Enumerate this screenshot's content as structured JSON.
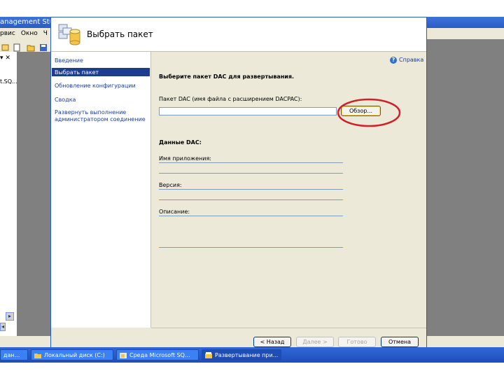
{
  "background_app": {
    "title": "anagement Stud",
    "menu": [
      "рвис",
      "Окно",
      "Ч"
    ],
    "explorer_close": "▾ ✕",
    "explorer_node": "t.SQ..."
  },
  "dialog": {
    "title": "Выбрать пакет",
    "help_label": "Справка",
    "nav": [
      {
        "label": "Введение",
        "selected": false
      },
      {
        "label": "Выбрать пакет",
        "selected": true
      },
      {
        "label": "Обновление конфигурации",
        "selected": false
      },
      {
        "label": "Сводка",
        "selected": false
      },
      {
        "label": "Развернуть выполнение администратором соединение",
        "selected": false
      }
    ],
    "heading": "Выберите пакет DAC для развертывания.",
    "package_label": "Пакет DAC (имя файла с расширением DACPAC):",
    "package_value": "",
    "browse_label": "Обзор...",
    "dac_section": "Данные DAC:",
    "app_name_label": "Имя приложения:",
    "version_label": "Версия:",
    "description_label": "Описание:",
    "buttons": {
      "back": "< Назад",
      "next": "Далее >",
      "finish": "Готово",
      "cancel": "Отмена"
    }
  },
  "taskbar": [
    {
      "label": "дан...",
      "icon": "database-icon"
    },
    {
      "label": "Локальный диск (C:)",
      "icon": "folder-icon"
    },
    {
      "label": "Среда Microsoft SQ...",
      "icon": "ssms-icon"
    },
    {
      "label": "Развертывание при...",
      "icon": "package-icon",
      "active": true
    }
  ],
  "colors": {
    "accent": "#2a5cc5",
    "highlight_circle": "#d0202a",
    "nav_selected": "#1e3c8c"
  }
}
